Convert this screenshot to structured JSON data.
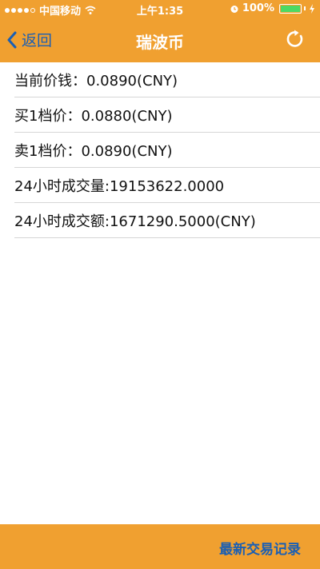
{
  "status_bar": {
    "carrier": "中国移动",
    "time": "上午1:35",
    "battery": "100%"
  },
  "nav": {
    "back_label": "返回",
    "title": "瑞波币"
  },
  "rows": [
    {
      "text": "当前价钱：0.0890(CNY)"
    },
    {
      "text": "买1档价：0.0880(CNY)"
    },
    {
      "text": "卖1档价：0.0890(CNY)"
    },
    {
      "text": "24小时成交量:19153622.0000"
    },
    {
      "text": "24小时成交额:1671290.5000(CNY)"
    }
  ],
  "bottom_bar": {
    "link_label": "最新交易记录"
  },
  "colors": {
    "accent": "#f0a030",
    "link": "#1a5fb4"
  }
}
